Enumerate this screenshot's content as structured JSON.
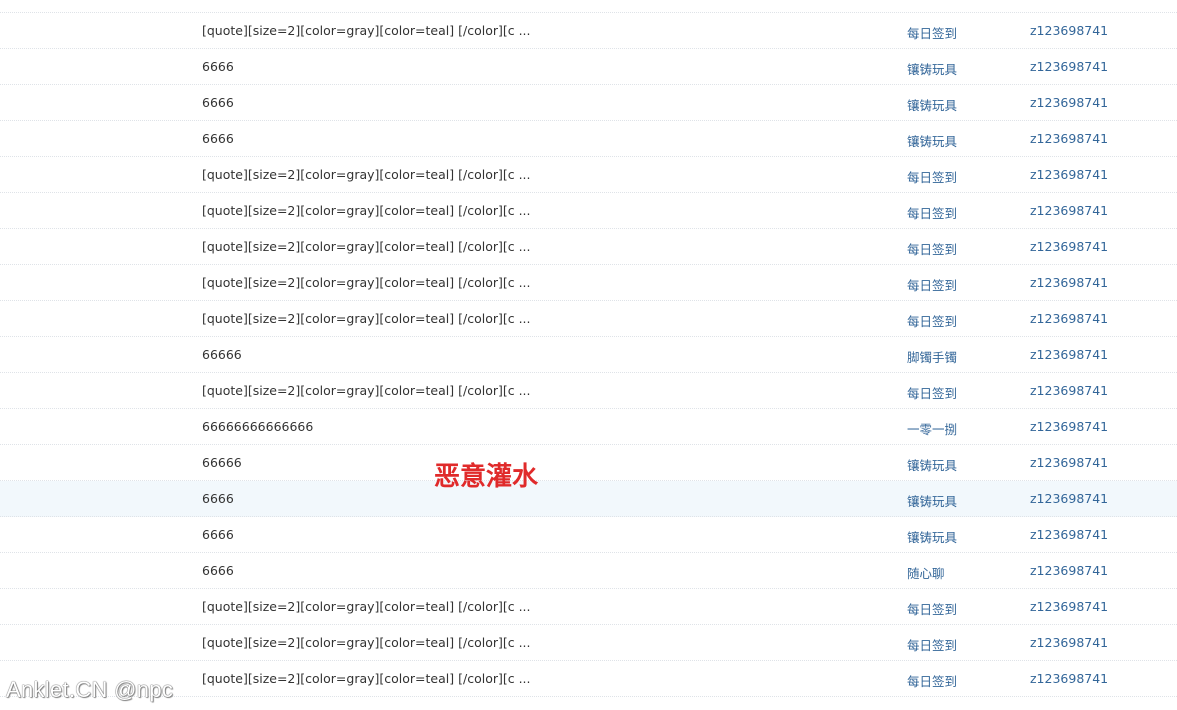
{
  "colors": {
    "subject_text": "#333333",
    "link_text": "#336699",
    "row_highlight": "#f2f8fc",
    "annotation": "#e02a2a"
  },
  "rows": [
    {
      "subject": "[quote][size=2][color=gray][color=teal] [/color][c ...",
      "forum": "每日签到",
      "author": "z123698741"
    },
    {
      "subject": "6666",
      "forum": "镶铸玩具",
      "author": "z123698741"
    },
    {
      "subject": "6666",
      "forum": "镶铸玩具",
      "author": "z123698741"
    },
    {
      "subject": "6666",
      "forum": "镶铸玩具",
      "author": "z123698741"
    },
    {
      "subject": "[quote][size=2][color=gray][color=teal] [/color][c ...",
      "forum": "每日签到",
      "author": "z123698741"
    },
    {
      "subject": "[quote][size=2][color=gray][color=teal] [/color][c ...",
      "forum": "每日签到",
      "author": "z123698741"
    },
    {
      "subject": "[quote][size=2][color=gray][color=teal] [/color][c ...",
      "forum": "每日签到",
      "author": "z123698741"
    },
    {
      "subject": "[quote][size=2][color=gray][color=teal] [/color][c ...",
      "forum": "每日签到",
      "author": "z123698741"
    },
    {
      "subject": "[quote][size=2][color=gray][color=teal] [/color][c ...",
      "forum": "每日签到",
      "author": "z123698741"
    },
    {
      "subject": "66666",
      "forum": "脚镯手镯",
      "author": "z123698741"
    },
    {
      "subject": "[quote][size=2][color=gray][color=teal] [/color][c ...",
      "forum": "每日签到",
      "author": "z123698741"
    },
    {
      "subject": "66666666666666",
      "forum": "一零一捌",
      "author": "z123698741"
    },
    {
      "subject": "66666",
      "forum": "镶铸玩具",
      "author": "z123698741"
    },
    {
      "subject": "6666",
      "forum": "镶铸玩具",
      "author": "z123698741"
    },
    {
      "subject": "6666",
      "forum": "镶铸玩具",
      "author": "z123698741"
    },
    {
      "subject": "6666",
      "forum": "随心聊",
      "author": "z123698741"
    },
    {
      "subject": "[quote][size=2][color=gray][color=teal] [/color][c ...",
      "forum": "每日签到",
      "author": "z123698741"
    },
    {
      "subject": "[quote][size=2][color=gray][color=teal] [/color][c ...",
      "forum": "每日签到",
      "author": "z123698741"
    },
    {
      "subject": "[quote][size=2][color=gray][color=teal] [/color][c ...",
      "forum": "每日签到",
      "author": "z123698741"
    }
  ],
  "annotation": {
    "text": "恶意灌水"
  },
  "watermark": {
    "text": "Anklet.CN @npc"
  }
}
